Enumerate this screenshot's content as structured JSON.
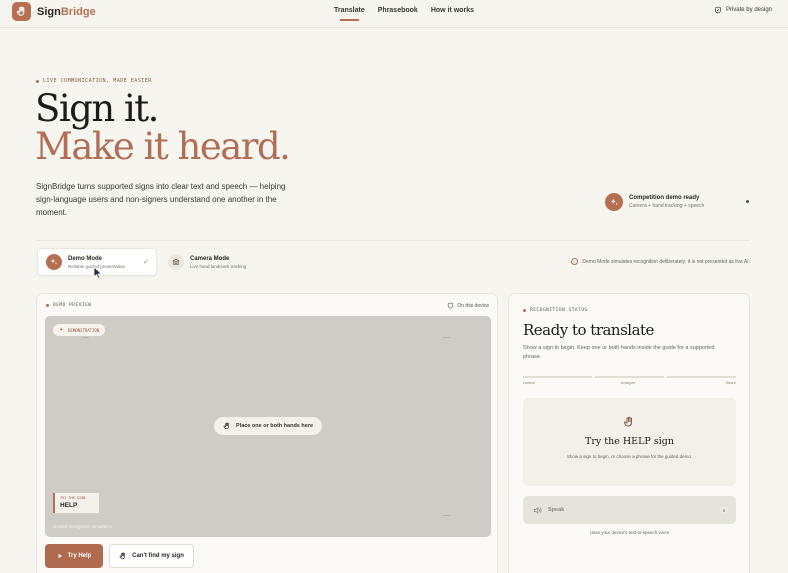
{
  "header": {
    "brand_prefix": "Sign",
    "brand_suffix": "Bridge",
    "nav": [
      "Translate",
      "Phrasebook",
      "How it works"
    ],
    "active_nav": "Translate",
    "privacy": "Private by design"
  },
  "hero": {
    "eyebrow": "LIVE COMMUNICATION, MADE EASIER",
    "title_line1": "Sign it.",
    "title_line2": "Make it heard.",
    "lede": "SignBridge turns supported signs into clear text and speech — helping sign-language users and non-signers understand one another in the moment."
  },
  "demo_ready": {
    "title": "Competition demo ready",
    "subtitle": "Camera + hand tracking + speech"
  },
  "modes": [
    {
      "title": "Demo Mode",
      "subtitle": "Reliable guided presentation",
      "selected": true
    },
    {
      "title": "Camera Mode",
      "subtitle": "Live hand landmark tracking",
      "selected": false
    }
  ],
  "mode_note": "Demo Mode simulates recognition deliberately; it is not presented as live AI.",
  "preview": {
    "label": "DEMO PREVIEW",
    "on_device": "On this device",
    "chip": "DEMONSTRATION",
    "place_hands": "Place one or both hands here",
    "try_sign_label": "TRY THE SIGN",
    "try_sign_value": "HELP",
    "guided_caption": "Guided recognition simulation",
    "primary_button": "Try Help",
    "secondary_button": "Can't find my sign"
  },
  "status": {
    "label": "RECOGNITION STATUS",
    "title": "Ready to translate",
    "subtitle": "Show a sign to begin. Keep one or both hands inside the guide for a supported phrase.",
    "steps": [
      "Detect",
      "Analyze",
      "Share"
    ],
    "prompt_title": "Try the HELP sign",
    "prompt_desc": "Show a sign to begin, or choose a phrase for the guided demo.",
    "speak_label": "Speak",
    "speak_key": "S",
    "tts_note": "Uses your device's text-to-speech voice"
  },
  "colors": {
    "accent": "#b76f52",
    "background": "#f7f5ef",
    "stage": "#cfcbc6"
  }
}
